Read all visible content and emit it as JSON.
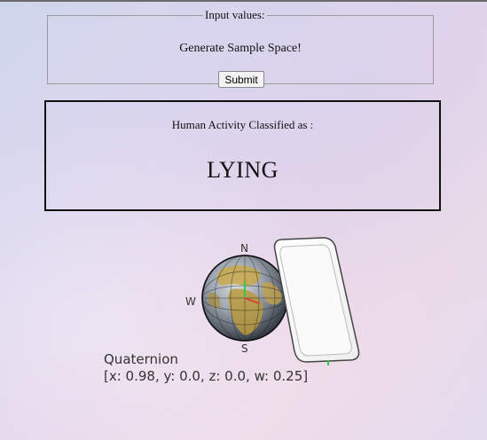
{
  "form": {
    "legend": "Input values:",
    "generate_label": "Generate Sample Space!",
    "submit_label": "Submit"
  },
  "result": {
    "caption": "Human Activity Classified as :",
    "activity": "LYING"
  },
  "orientation": {
    "compass": {
      "north": "N",
      "west": "W",
      "south": "S"
    },
    "quaternion_title": "Quaternion",
    "quaternion_text": "[x: 0.98, y: 0.0, z: 0.0, w: 0.25]"
  }
}
